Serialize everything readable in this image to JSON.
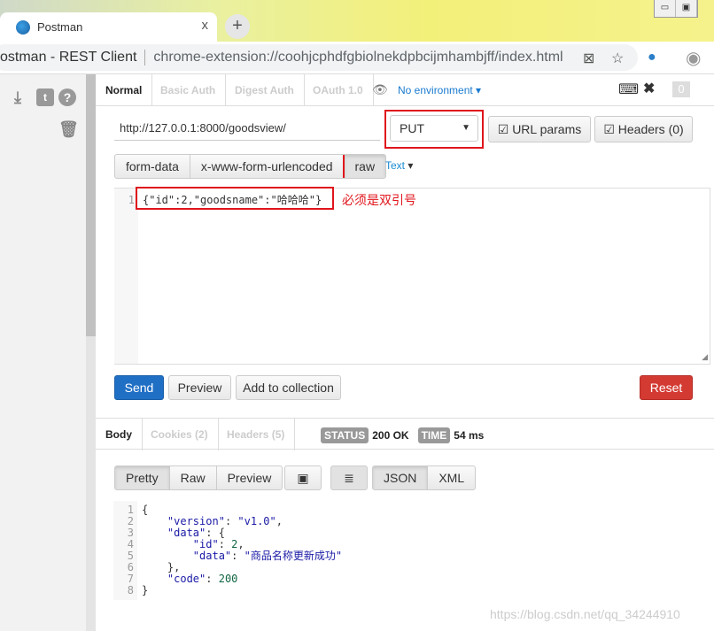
{
  "browser": {
    "tab_title": "Postman",
    "new_tab": "+",
    "close": "x",
    "site_name": "ostman - REST Client",
    "url": "chrome-extension://coohjcphdfgbiolnekdpbcijmhambjff/index.html"
  },
  "auth_tabs": [
    "Normal",
    "Basic Auth",
    "Digest Auth",
    "OAuth 1.0"
  ],
  "environment": "No environment",
  "counter": "0",
  "request": {
    "url": "http://127.0.0.1:8000/goodsview/",
    "method": "PUT",
    "url_params": "URL params",
    "headers": "Headers (0)"
  },
  "body_types": [
    "form-data",
    "x-www-form-urlencoded",
    "raw"
  ],
  "raw_type": "Text",
  "editor": {
    "line": "1",
    "code": "{\"id\":2,\"goodsname\":\"哈哈哈\"}",
    "annotation": "必须是双引号"
  },
  "actions": {
    "send": "Send",
    "preview": "Preview",
    "add": "Add to collection",
    "reset": "Reset"
  },
  "response_tabs": [
    "Body",
    "Cookies (2)",
    "Headers (5)"
  ],
  "status": {
    "label": "STATUS",
    "value": "200 OK",
    "time_label": "TIME",
    "time_value": "54 ms"
  },
  "view_modes": [
    "Pretty",
    "Raw",
    "Preview"
  ],
  "formats": [
    "JSON",
    "XML"
  ],
  "response_lines": [
    "1",
    "2",
    "3",
    "4",
    "5",
    "6",
    "7",
    "8"
  ],
  "response": {
    "version": "v1.0",
    "id": "2",
    "data": "商品名称更新成功",
    "code": "200"
  },
  "watermark": "https://blog.csdn.net/qq_34244910",
  "colors": {
    "send": "#1f6fc5",
    "reset": "#d33a32",
    "annotation": "#e0151c"
  }
}
